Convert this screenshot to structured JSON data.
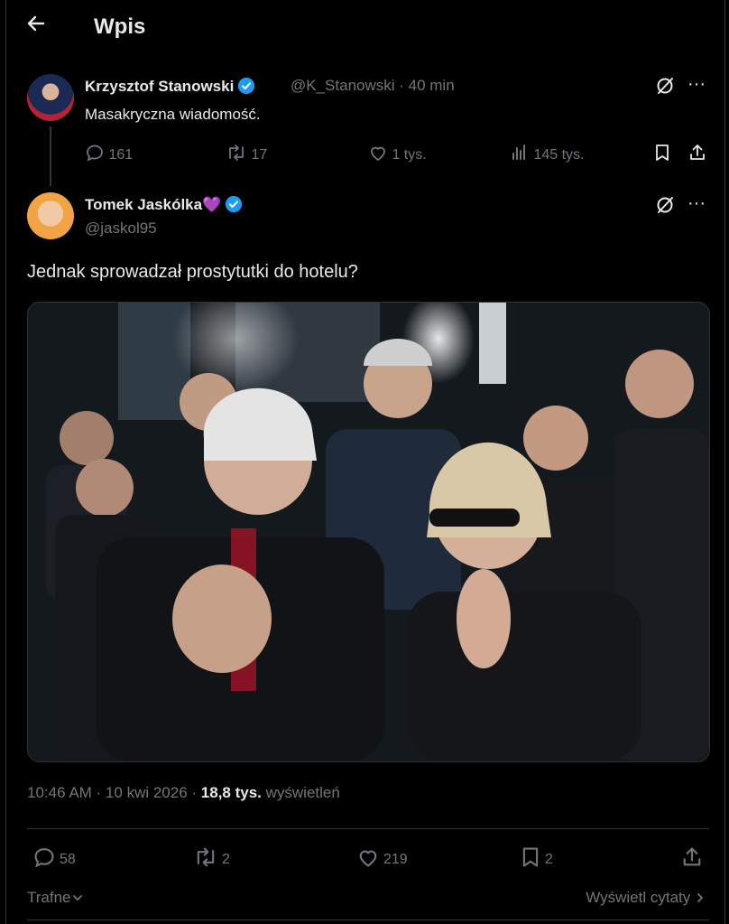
{
  "header": {
    "back_icon": "arrow-left-icon",
    "title": "Wpis"
  },
  "parent_tweet": {
    "author_name": "Krzysztof Stanowski",
    "handle_time": "@K_Stanowski · 40 min",
    "text": "Masakryczna wiadomość.",
    "replies": "161",
    "retweets": "17",
    "likes": "1 tys.",
    "views": "145 tys."
  },
  "main_tweet": {
    "author_name": "Tomek Jaskólka💜",
    "handle": "@jaskol95",
    "text": "Jednak sprowadzał prostytutki do hotelu?",
    "timestamp": "10:46 AM · 10 kwi 2026 · ",
    "views_count": "18,8 tys.",
    "views_label": " wyświetleń",
    "replies": "58",
    "retweets": "2",
    "likes": "219",
    "bookmarks": "2"
  },
  "footer": {
    "sort_label": "Trafne",
    "quotes_label": "Wyświetl cytaty"
  },
  "colors": {
    "background": "#000000",
    "text": "#e7e9ea",
    "muted": "#71767b",
    "verified": "#1d9bf0",
    "divider": "#2f3336"
  }
}
